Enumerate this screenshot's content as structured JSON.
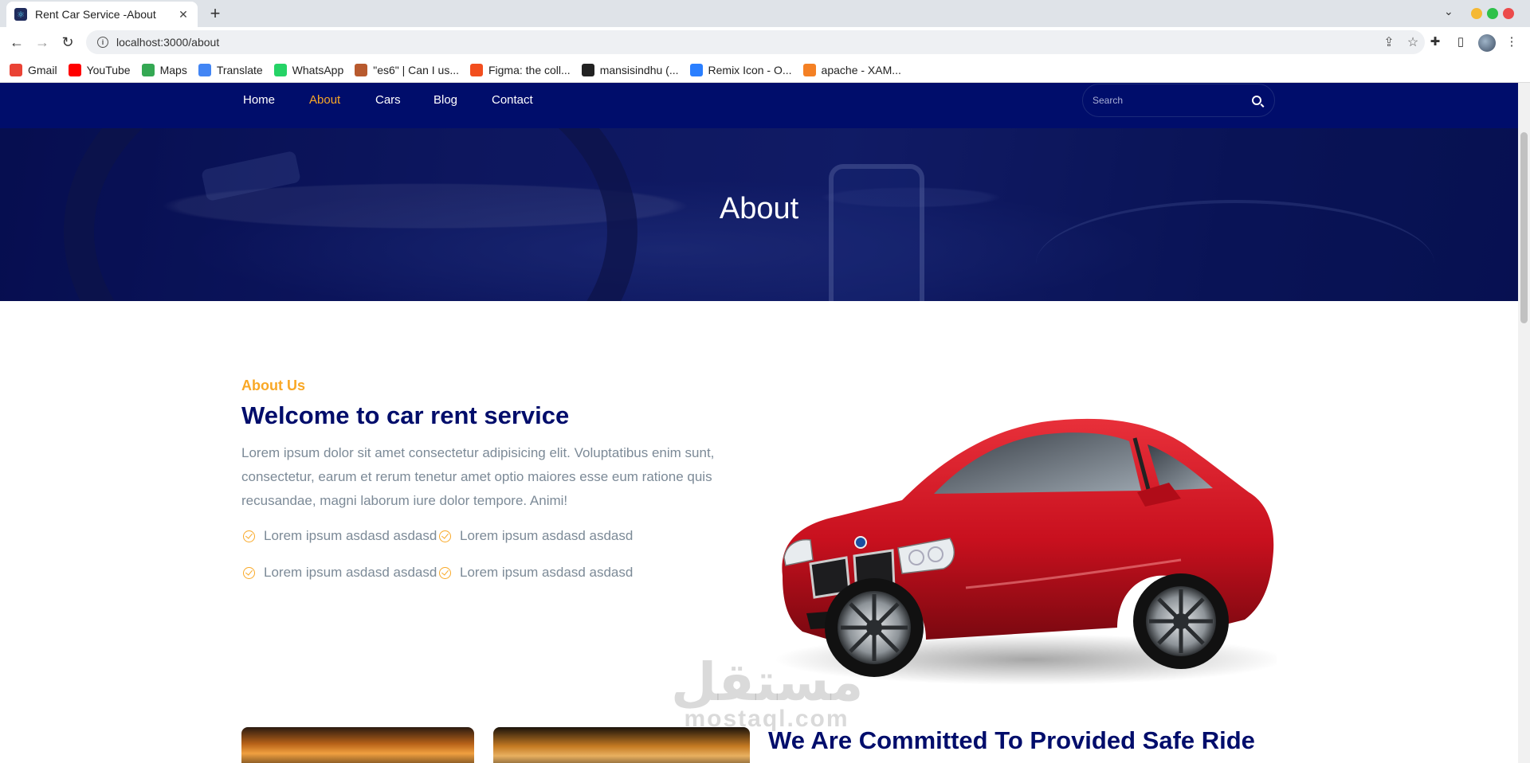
{
  "browser": {
    "tab_title": "Rent Car Service -About",
    "url": "localhost:3000/about",
    "bookmarks": [
      {
        "label": "Gmail",
        "icon": "gmail-icon",
        "color": "#ea4335"
      },
      {
        "label": "YouTube",
        "icon": "youtube-icon",
        "color": "#ff0000"
      },
      {
        "label": "Maps",
        "icon": "maps-icon",
        "color": "#34a853"
      },
      {
        "label": "Translate",
        "icon": "translate-icon",
        "color": "#4285f4"
      },
      {
        "label": "WhatsApp",
        "icon": "whatsapp-icon",
        "color": "#25d366"
      },
      {
        "label": "\"es6\" | Can I us...",
        "icon": "caniuse-icon",
        "color": "#b85a2e"
      },
      {
        "label": "Figma: the coll...",
        "icon": "figma-icon",
        "color": "#f24e1e"
      },
      {
        "label": "mansisindhu (...",
        "icon": "github-icon",
        "color": "#222222"
      },
      {
        "label": "Remix Icon - O...",
        "icon": "remixicon-icon",
        "color": "#2a7fff"
      },
      {
        "label": "apache - XAM...",
        "icon": "stackoverflow-icon",
        "color": "#f48024"
      }
    ]
  },
  "site": {
    "nav": [
      {
        "label": "Home",
        "active": false
      },
      {
        "label": "About",
        "active": true
      },
      {
        "label": "Cars",
        "active": false
      },
      {
        "label": "Blog",
        "active": false
      },
      {
        "label": "Contact",
        "active": false
      }
    ],
    "search_placeholder": "Search",
    "hero_title": "About",
    "about": {
      "subtitle": "About Us",
      "title": "Welcome to car rent service",
      "text": "Lorem ipsum dolor sit amet consectetur adipisicing elit. Voluptatibus enim sunt, consectetur, earum et rerum tenetur amet optio maiores esse eum ratione quis recusandae, magni laborum iure dolor tempore. Animi!",
      "features": [
        "Lorem ipsum asdasd asdasd",
        "Lorem ipsum asdasd asdasd",
        "Lorem ipsum asdasd asdasd",
        "Lorem ipsum asdasd asdasd"
      ]
    },
    "commitment_title": "We Are Committed To Provided Safe Ride",
    "watermark": {
      "arabic": "مستقل",
      "latin": "mostaql.com"
    }
  },
  "colors": {
    "nav_bg": "#000d6b",
    "accent": "#f9a826",
    "heading": "#000d6b",
    "body_text": "#7c8a97",
    "car_red": "#c8101e"
  }
}
